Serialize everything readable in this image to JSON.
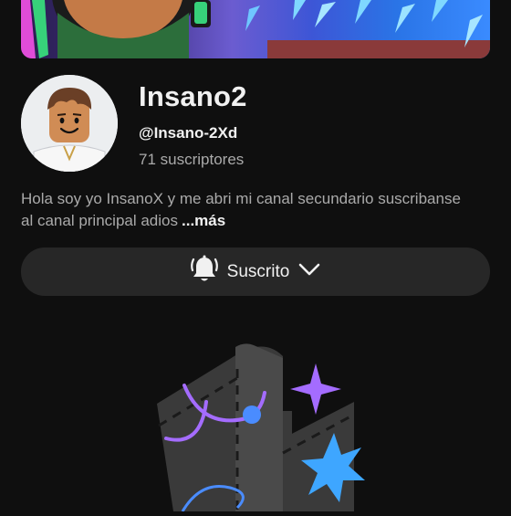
{
  "channel": {
    "name": "Insano2",
    "handle": "@Insano-2Xd",
    "subscribers": "71 suscriptores"
  },
  "description": {
    "line1": "Hola soy yo InsanoX y me abri mi canal secundario suscribanse",
    "line2": "al canal principal adios",
    "more_label": "...más"
  },
  "subscribe_button": {
    "label": "Suscrito",
    "bell_icon": "bell-icon",
    "chevron_icon": "chevron-down-icon"
  },
  "colors": {
    "background": "#0f0f0f",
    "button": "#272727",
    "secondary_text": "#aaaaaa",
    "accent_purple": "#a46cff",
    "accent_blue": "#3ea6ff"
  }
}
